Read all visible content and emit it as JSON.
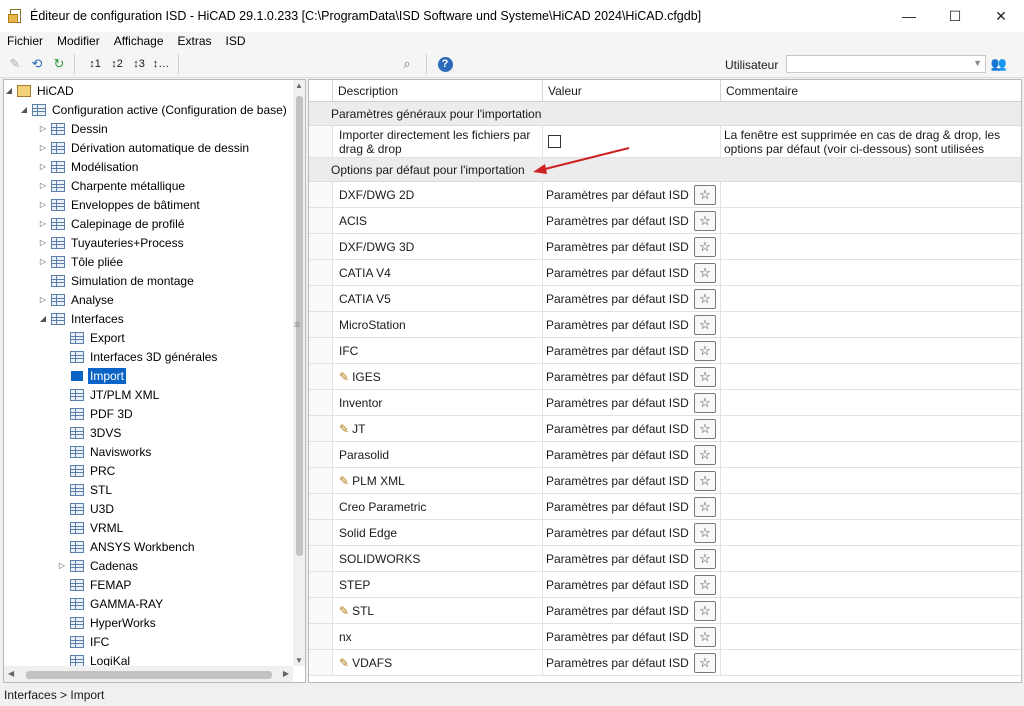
{
  "window": {
    "title": "Éditeur de configuration ISD - HiCAD 29.1.0.233 [C:\\ProgramData\\ISD Software und Systeme\\HiCAD 2024\\HiCAD.cfgdb]",
    "minimize": "—",
    "maximize": "☐",
    "close": "✕"
  },
  "menu": [
    "Fichier",
    "Modifier",
    "Affichage",
    "Extras",
    "ISD"
  ],
  "toolbar": {
    "user_label": "Utilisateur",
    "user_value": ""
  },
  "tree": {
    "root": "HiCAD",
    "config": "Configuration active (Configuration de base)",
    "items": [
      "Dessin",
      "Dérivation automatique de dessin",
      "Modélisation",
      "Charpente métallique",
      "Enveloppes de bâtiment",
      "Calepinage de profilé",
      "Tuyauteries+Process",
      "Tôle pliée",
      "Simulation de montage",
      "Analyse",
      "Interfaces"
    ],
    "interfaces": [
      "Export",
      "Interfaces 3D générales",
      "Import",
      "JT/PLM XML",
      "PDF 3D",
      "3DVS",
      "Navisworks",
      "PRC",
      "STL",
      "U3D",
      "VRML",
      "ANSYS Workbench",
      "Cadenas",
      "FEMAP",
      "GAMMA-RAY",
      "HyperWorks",
      "IFC",
      "LogiKal"
    ]
  },
  "grid": {
    "headers": {
      "description": "Description",
      "value": "Valeur",
      "comment": "Commentaire"
    },
    "group1": "Paramètres généraux pour l'importation",
    "drag_row": {
      "description": "Importer directement les fichiers par drag & drop",
      "comment": "La fenêtre est supprimée en cas de drag & drop, les options par défaut (voir ci-dessous) sont utilisées"
    },
    "group2": "Options par défaut pour l'importation",
    "default_value": "Paramètres par défaut ISD",
    "rows": [
      {
        "name": "DXF/DWG 2D",
        "edited": false
      },
      {
        "name": "ACIS",
        "edited": false
      },
      {
        "name": "DXF/DWG 3D",
        "edited": false
      },
      {
        "name": "CATIA V4",
        "edited": false
      },
      {
        "name": "CATIA V5",
        "edited": false
      },
      {
        "name": "MicroStation",
        "edited": false
      },
      {
        "name": "IFC",
        "edited": false
      },
      {
        "name": "IGES",
        "edited": true
      },
      {
        "name": "Inventor",
        "edited": false
      },
      {
        "name": "JT",
        "edited": true
      },
      {
        "name": "Parasolid",
        "edited": false
      },
      {
        "name": "PLM XML",
        "edited": true
      },
      {
        "name": "Creo Parametric",
        "edited": false
      },
      {
        "name": "Solid Edge",
        "edited": false
      },
      {
        "name": "SOLIDWORKS",
        "edited": false
      },
      {
        "name": "STEP",
        "edited": false
      },
      {
        "name": "STL",
        "edited": true
      },
      {
        "name": "nx",
        "edited": false
      },
      {
        "name": "VDAFS",
        "edited": true
      }
    ]
  },
  "status": "Interfaces > Import",
  "colors": {
    "selection": "#0a64c8",
    "annotation_arrow": "#cc2222"
  }
}
